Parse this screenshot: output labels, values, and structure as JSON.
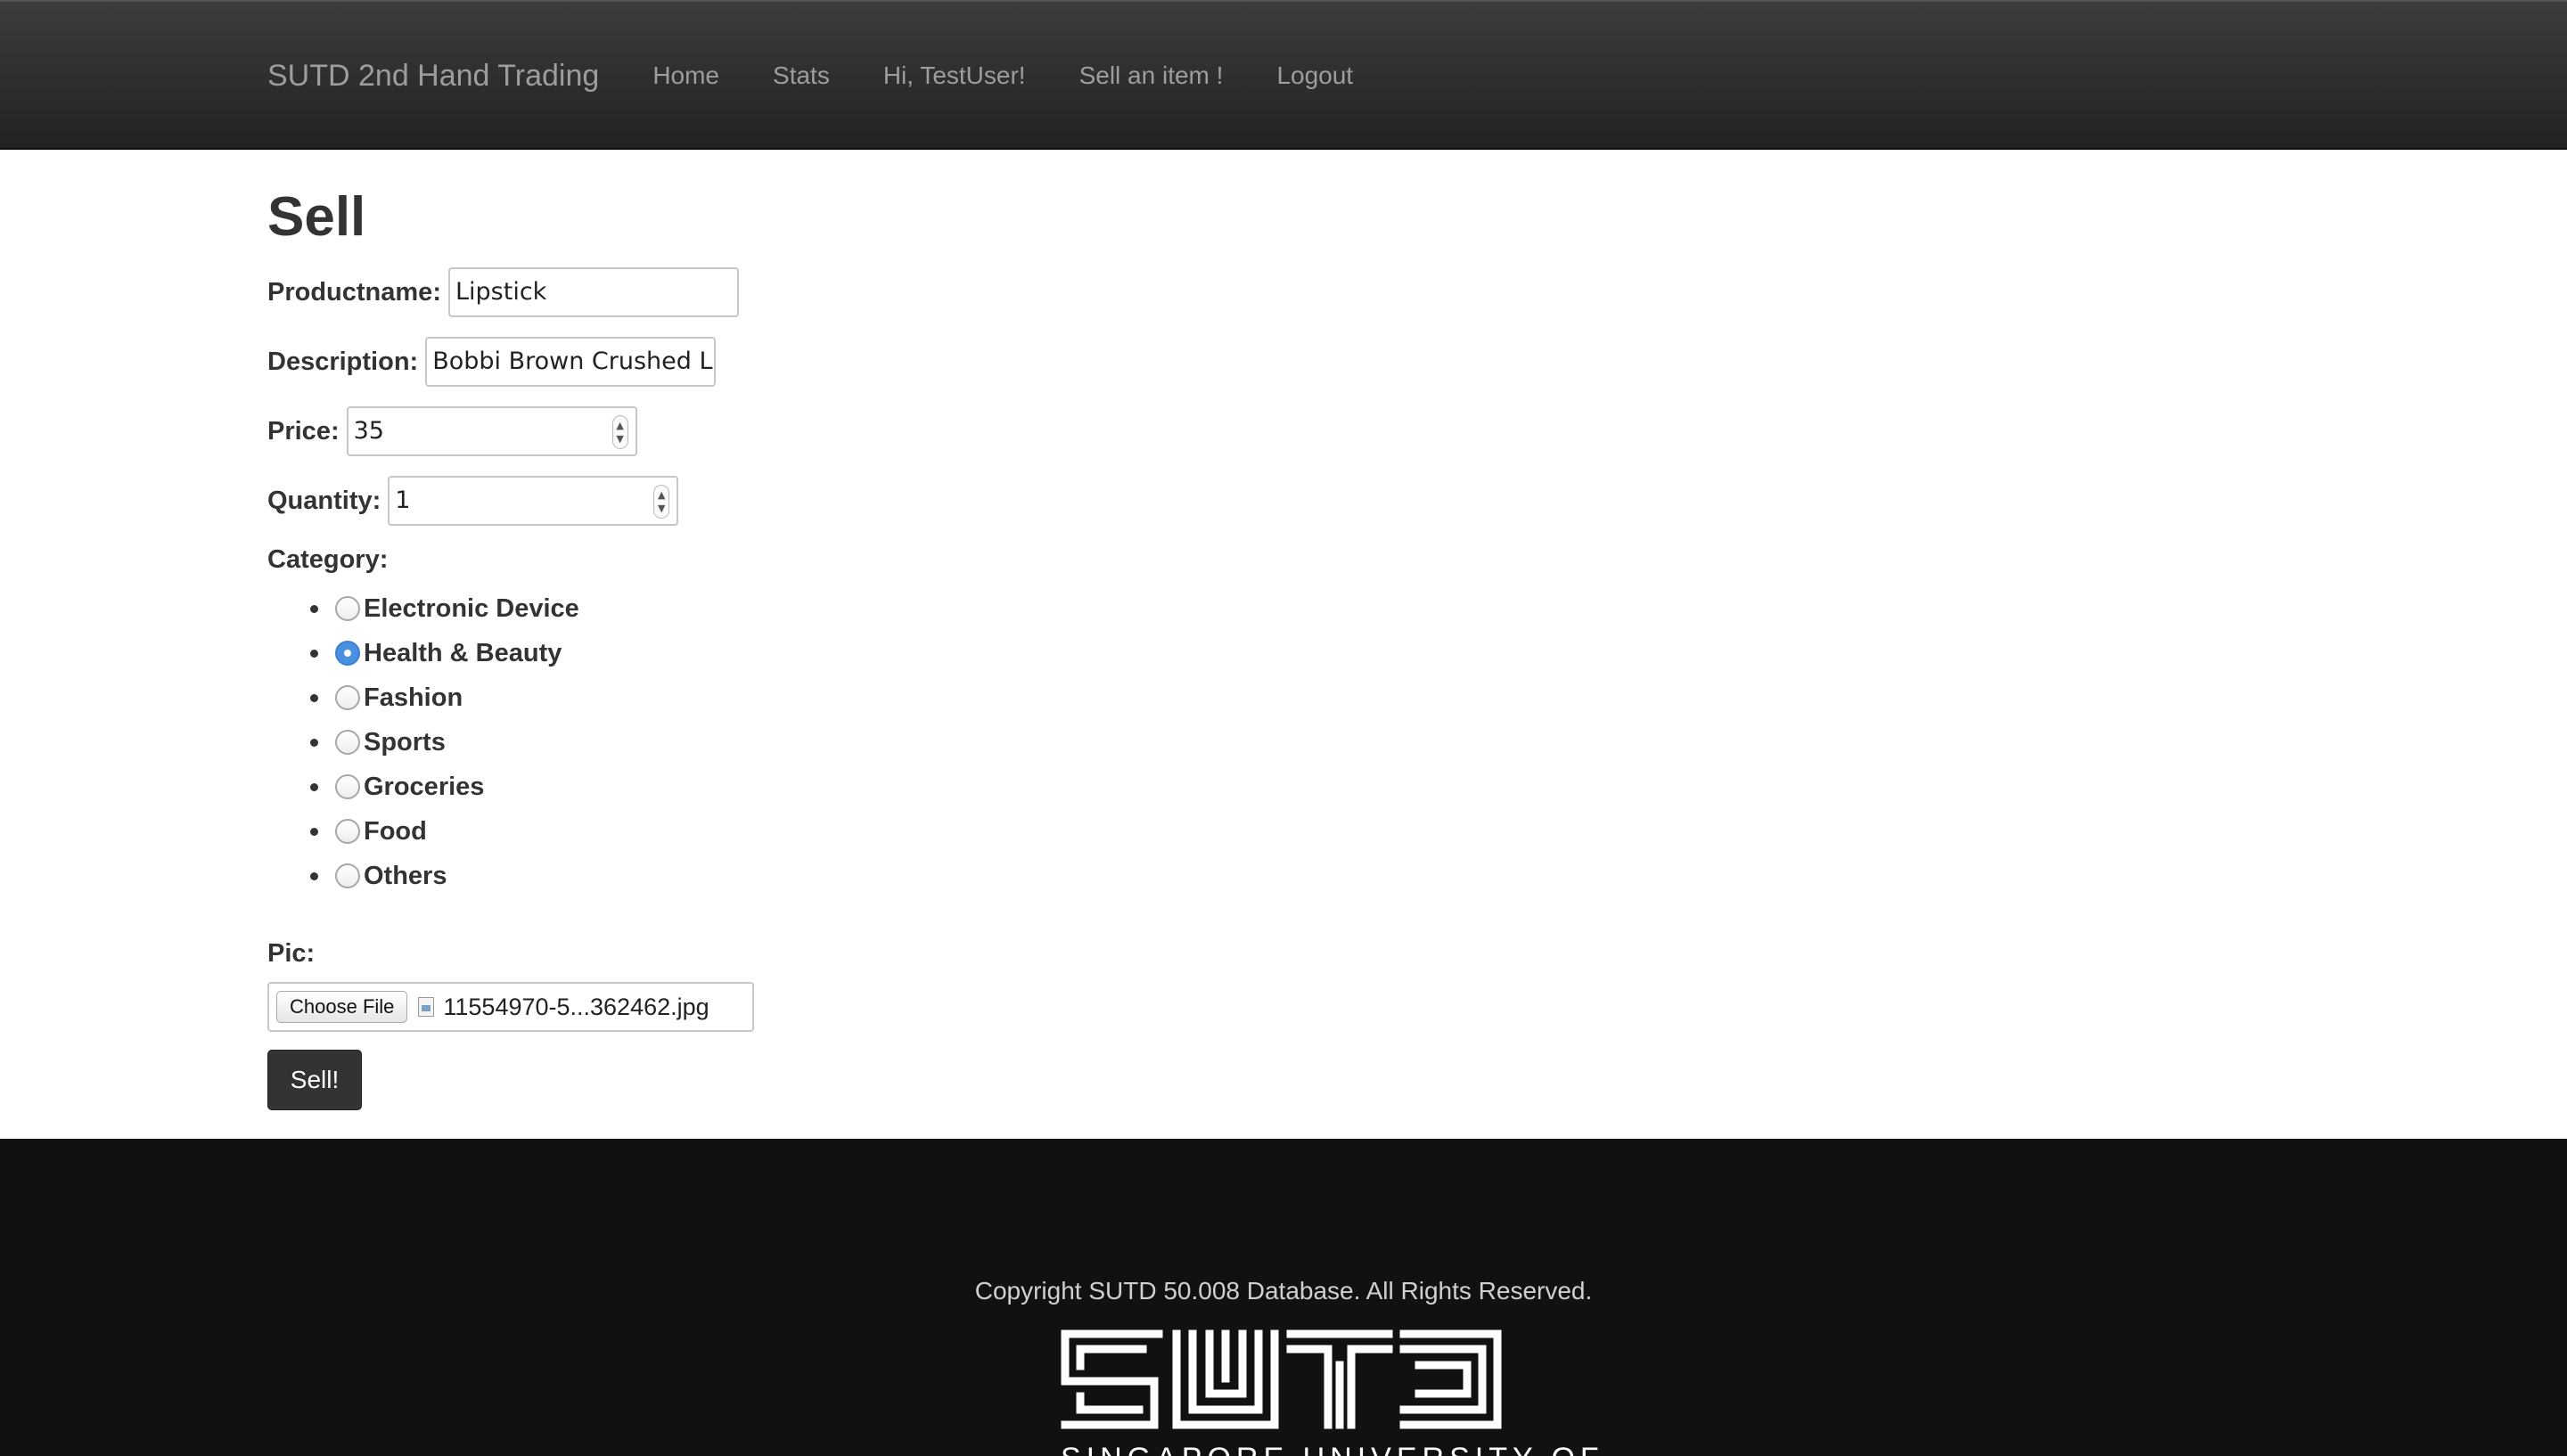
{
  "navbar": {
    "brand": "SUTD 2nd Hand Trading",
    "links": [
      "Home",
      "Stats",
      "Hi, TestUser!",
      "Sell an item !",
      "Logout"
    ]
  },
  "page": {
    "title": "Sell"
  },
  "form": {
    "productname_label": "Productname:",
    "productname_value": "Lipstick",
    "description_label": "Description:",
    "description_value": "Bobbi Brown Crushed Lip",
    "price_label": "Price:",
    "price_value": "35",
    "quantity_label": "Quantity:",
    "quantity_value": "1",
    "category_label": "Category:",
    "categories": [
      {
        "label": "Electronic Device",
        "checked": false
      },
      {
        "label": "Health & Beauty",
        "checked": true
      },
      {
        "label": "Fashion",
        "checked": false
      },
      {
        "label": "Sports",
        "checked": false
      },
      {
        "label": "Groceries",
        "checked": false
      },
      {
        "label": "Food",
        "checked": false
      },
      {
        "label": "Others",
        "checked": false
      }
    ],
    "pic_label": "Pic:",
    "choose_file_label": "Choose File",
    "file_name": "11554970-5...362462.jpg",
    "submit_label": "Sell!"
  },
  "footer": {
    "copyright": "Copyright SUTD 50.008 Database. All Rights Reserved.",
    "logo_text": "SUTD",
    "logo_tagline": "SINGAPORE UNIVERSITY OF"
  },
  "colors": {
    "navbar_bg": "#222222",
    "nav_text": "#9d9d9d",
    "radio_checked": "#4a90e2",
    "button_bg": "#333333",
    "footer_bg": "#111111"
  }
}
